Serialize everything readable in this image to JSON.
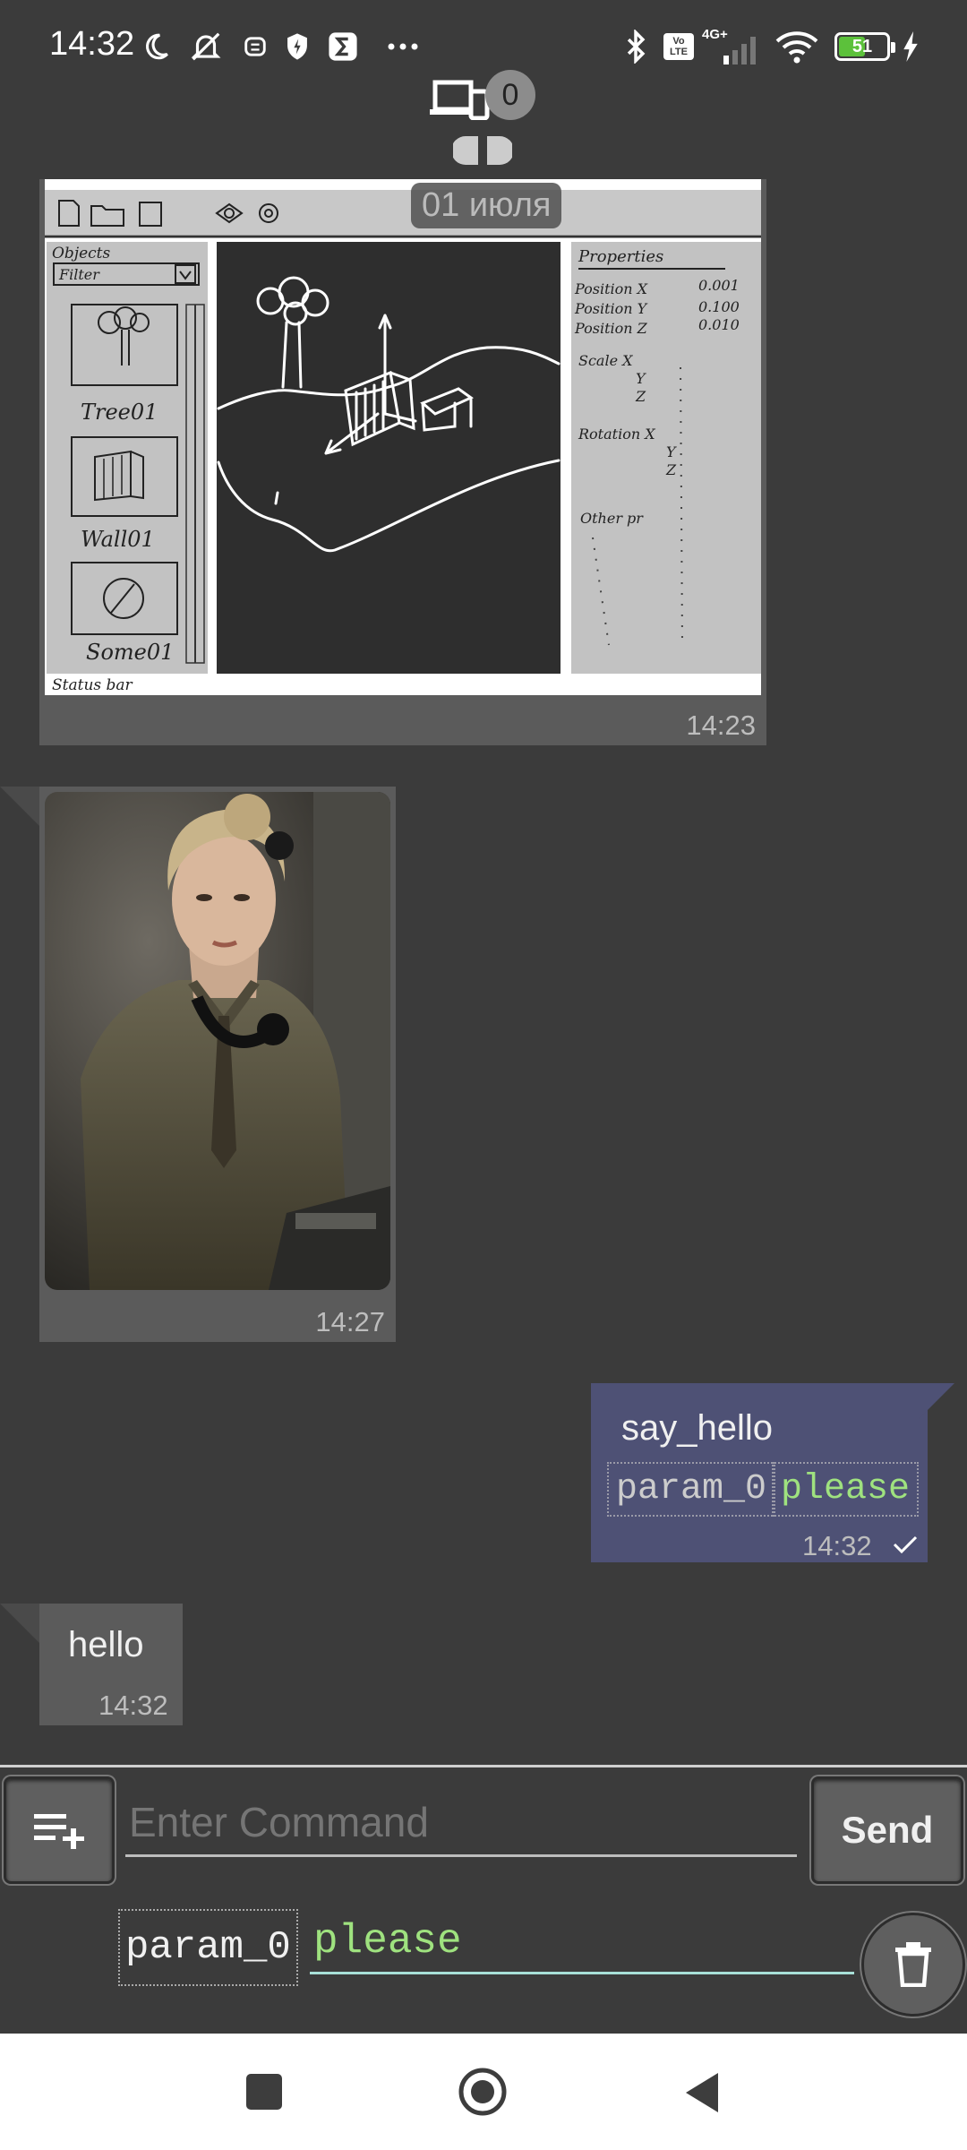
{
  "status_bar": {
    "time": "14:32",
    "battery_level": "51",
    "network": "4G+",
    "volte": "Vo LTE",
    "left_icons": [
      "moon-icon",
      "muted-bell-icon",
      "robot-icon",
      "shield-icon",
      "sigma-icon",
      "more-dots-icon"
    ],
    "right_icons": [
      "bluetooth-icon",
      "volte-icon",
      "signal-icon",
      "wifi-icon",
      "battery-icon",
      "charging-icon"
    ]
  },
  "header": {
    "connected_devices_count": "0",
    "date_separator": "01 июля"
  },
  "messages": [
    {
      "type": "image",
      "direction": "incoming",
      "content": "sketch-image",
      "time": "14:23"
    },
    {
      "type": "image",
      "direction": "incoming",
      "content": "photo-image",
      "time": "14:27"
    },
    {
      "type": "command",
      "direction": "outgoing",
      "command": "say_hello",
      "param_name": "param_0",
      "param_value": "please",
      "time": "14:32",
      "status": "sent"
    },
    {
      "type": "text",
      "direction": "incoming",
      "text": "hello",
      "time": "14:32"
    }
  ],
  "sketch": {
    "objects_title": "Objects",
    "filter_label": "Filter",
    "items": [
      "Tree01",
      "Wall01",
      "Some01"
    ],
    "statusbar_label": "Status bar",
    "properties_title": "Properties",
    "properties": [
      {
        "name": "Position X",
        "value": "0.001"
      },
      {
        "name": "Position Y",
        "value": "0.100"
      },
      {
        "name": "Position Z",
        "value": "0.010"
      },
      {
        "name": "Scale X",
        "value": ""
      },
      {
        "name": "Y",
        "value": ""
      },
      {
        "name": "Z",
        "value": ""
      },
      {
        "name": "Rotation X",
        "value": ""
      },
      {
        "name": "Y",
        "value": ""
      },
      {
        "name": "Z",
        "value": ""
      },
      {
        "name": "Other pr",
        "value": ""
      }
    ]
  },
  "composer": {
    "command_placeholder": "Enter Command",
    "send_label": "Send",
    "param_name": "param_0",
    "param_value": "please"
  },
  "colors": {
    "background": "#3b3b3b",
    "incoming_bubble": "#5b5b5b",
    "outgoing_bubble": "#4e5175",
    "param_value_green": "#9fe27f",
    "battery_green": "#5cc13b"
  }
}
